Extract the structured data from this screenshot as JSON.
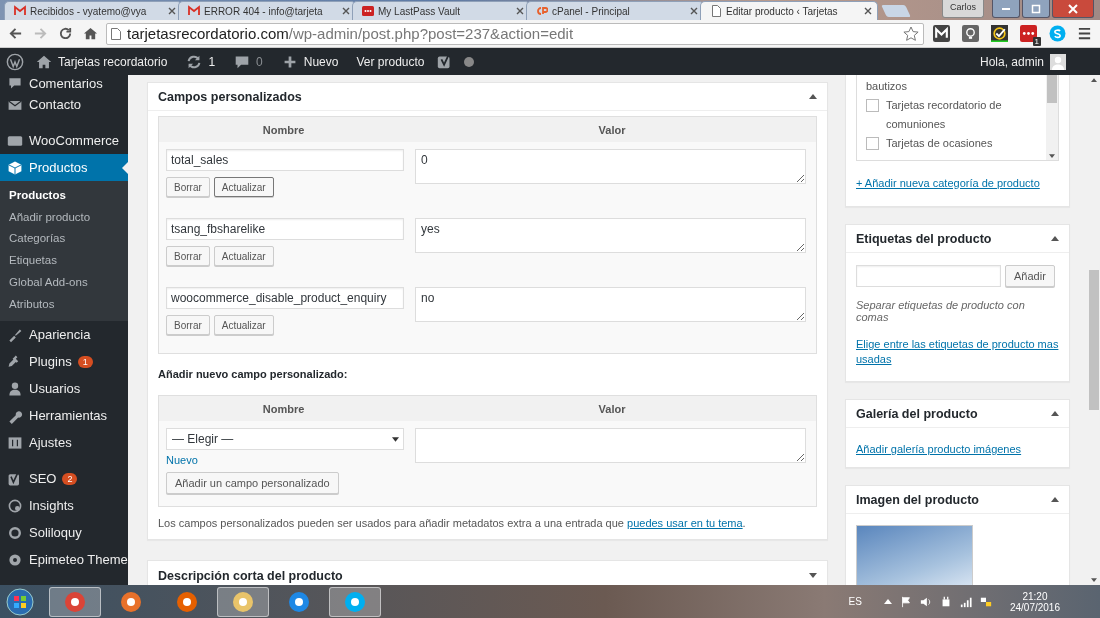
{
  "browser": {
    "tabs": [
      {
        "title": "Recibidos - vyatemo@vya",
        "selected": false
      },
      {
        "title": "ERROR 404 - info@tarjeta",
        "selected": false
      },
      {
        "title": "My LastPass Vault",
        "selected": false
      },
      {
        "title": "cPanel - Principal",
        "selected": false
      },
      {
        "title": "Editar producto ‹ Tarjetas",
        "selected": true
      }
    ],
    "profile": "Carlos",
    "host": "tarjetasrecordatorio.com",
    "path": "/wp-admin/post.php?post=237&action=edit",
    "extension_badge": "1"
  },
  "admin_bar": {
    "site_name": "Tarjetas recordatorio",
    "updates": "1",
    "comments": "0",
    "new_label": "Nuevo",
    "view_label": "Ver producto",
    "greeting": "Hola, admin"
  },
  "sidebar": {
    "groups": [
      [
        {
          "label": "Comentarios",
          "selected": false
        },
        {
          "label": "Contacto",
          "selected": false
        }
      ],
      [
        {
          "label": "WooCommerce",
          "selected": false
        },
        {
          "label": "Productos",
          "selected": true,
          "children": [
            {
              "label": "Productos",
              "selected": true
            },
            {
              "label": "Añadir producto",
              "selected": false
            },
            {
              "label": "Categorías",
              "selected": false
            },
            {
              "label": "Etiquetas",
              "selected": false
            },
            {
              "label": "Global Add-ons",
              "selected": false
            },
            {
              "label": "Atributos",
              "selected": false
            }
          ]
        }
      ],
      [
        {
          "label": "Apariencia",
          "selected": false
        },
        {
          "label": "Plugins",
          "selected": false,
          "badge": "1"
        },
        {
          "label": "Usuarios",
          "selected": false
        },
        {
          "label": "Herramientas",
          "selected": false
        },
        {
          "label": "Ajustes",
          "selected": false
        }
      ],
      [
        {
          "label": "SEO",
          "selected": false,
          "badge": "2"
        },
        {
          "label": "Insights",
          "selected": false
        },
        {
          "label": "Soliloquy",
          "selected": false
        },
        {
          "label": "Epimeteo Theme",
          "selected": false
        }
      ]
    ]
  },
  "custom_fields": {
    "title": "Campos personalizados",
    "expanded": true,
    "columns": [
      "Nombre",
      "Valor"
    ],
    "rows": [
      {
        "name": "total_sales",
        "value": "0",
        "delete_label": "Borrar",
        "update_label": "Actualizar",
        "focused": true
      },
      {
        "name": "tsang_fbsharelike",
        "value": "yes",
        "delete_label": "Borrar",
        "update_label": "Actualizar",
        "focused": false
      },
      {
        "name": "woocommerce_disable_product_enquiry",
        "value": "no",
        "delete_label": "Borrar",
        "update_label": "Actualizar",
        "focused": false
      }
    ],
    "add_heading": "Añadir nuevo campo personalizado:",
    "add_columns": [
      "Nombre",
      "Valor"
    ],
    "select_value": "— Elegir —",
    "new_link": "Nuevo",
    "add_button": "Añadir un campo personalizado",
    "note": "Los campos personalizados pueden ser usados para añadir metadatos extra a una entrada que ",
    "note_link": "puedes usar en tu tema",
    "note_end": "."
  },
  "short_description": {
    "title": "Descripción corta del producto",
    "expanded": false
  },
  "categories": {
    "items": [
      {
        "label": "bautizos",
        "kind": "continued"
      },
      {
        "label": "Tarjetas recordatorio de comuniones",
        "kind": "checkbox",
        "checked": false
      },
      {
        "label": "Tarjetas de ocasiones",
        "kind": "checkbox",
        "checked": false
      }
    ],
    "add_link": "+ Añadir nueva categoría de producto"
  },
  "tags": {
    "title": "Etiquetas del producto",
    "expanded": true,
    "button": "Añadir",
    "hint": "Separar etiquetas de producto con comas",
    "link": "Elige entre las etiquetas de producto mas usadas"
  },
  "gallery": {
    "title": "Galería del producto",
    "expanded": true,
    "link": "Añadir galería producto imágenes"
  },
  "product_image": {
    "title": "Imagen del producto",
    "expanded": true
  },
  "taskbar": {
    "apps": [
      {
        "running": true
      },
      {
        "running": false
      },
      {
        "running": false
      },
      {
        "running": true
      },
      {
        "running": false
      },
      {
        "running": true
      }
    ],
    "language": "ES",
    "time": "21:20",
    "date": "24/07/2016"
  }
}
